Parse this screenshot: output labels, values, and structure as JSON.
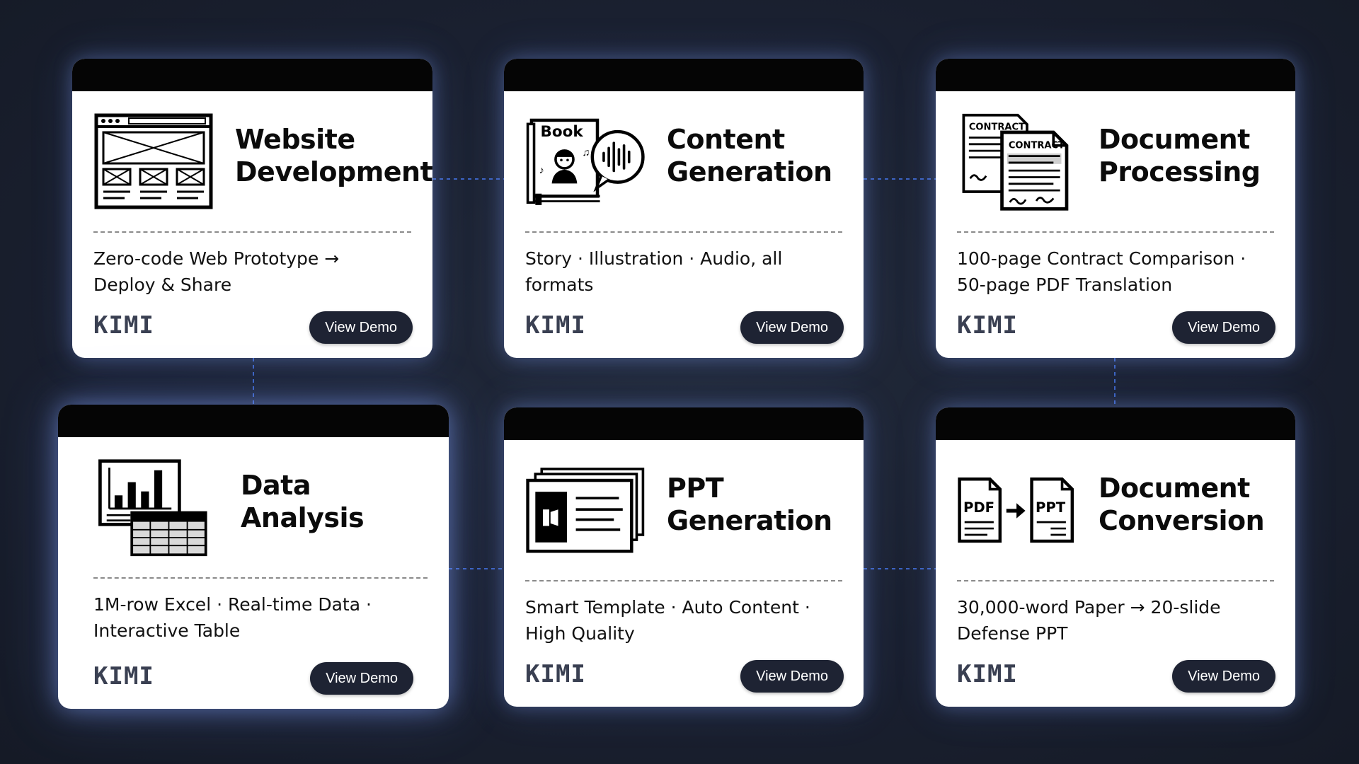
{
  "brand": "KIMI",
  "cards": [
    {
      "title_line1": "Website",
      "title_line2": "Development",
      "desc_line1": "Zero-code Web Prototype →",
      "desc_line2": "Deploy & Share",
      "button": "View Demo",
      "icon": "website-wireframe-icon"
    },
    {
      "title_line1": "Content",
      "title_line2": "Generation",
      "desc_line1": "Story · Illustration · Audio, all formats",
      "desc_line2": "",
      "button": "View Demo",
      "icon": "book-audio-icon",
      "icon_text": "Book"
    },
    {
      "title_line1": "Document",
      "title_line2": "Processing",
      "desc_line1": "100-page Contract Comparison ·",
      "desc_line2": "50-page PDF Translation",
      "button": "View Demo",
      "icon": "contract-documents-icon",
      "icon_text_1": "CONTRACT",
      "icon_text_2": "CONTRACT"
    },
    {
      "title_line1": "Data",
      "title_line2": "Analysis",
      "desc_line1": "1M-row Excel · Real-time Data ·",
      "desc_line2": "Interactive Table",
      "button": "View Demo",
      "icon": "chart-table-icon"
    },
    {
      "title_line1": "PPT",
      "title_line2": "Generation",
      "desc_line1": "Smart Template · Auto Content ·",
      "desc_line2": "High Quality",
      "button": "View Demo",
      "icon": "slides-stack-icon"
    },
    {
      "title_line1": "Document",
      "title_line2": "Conversion",
      "desc_line1": "30,000-word Paper → 20-slide",
      "desc_line2": "Defense PPT",
      "button": "View Demo",
      "icon": "pdf-to-ppt-icon",
      "icon_text_1": "PDF",
      "icon_text_2": "PPT"
    }
  ]
}
